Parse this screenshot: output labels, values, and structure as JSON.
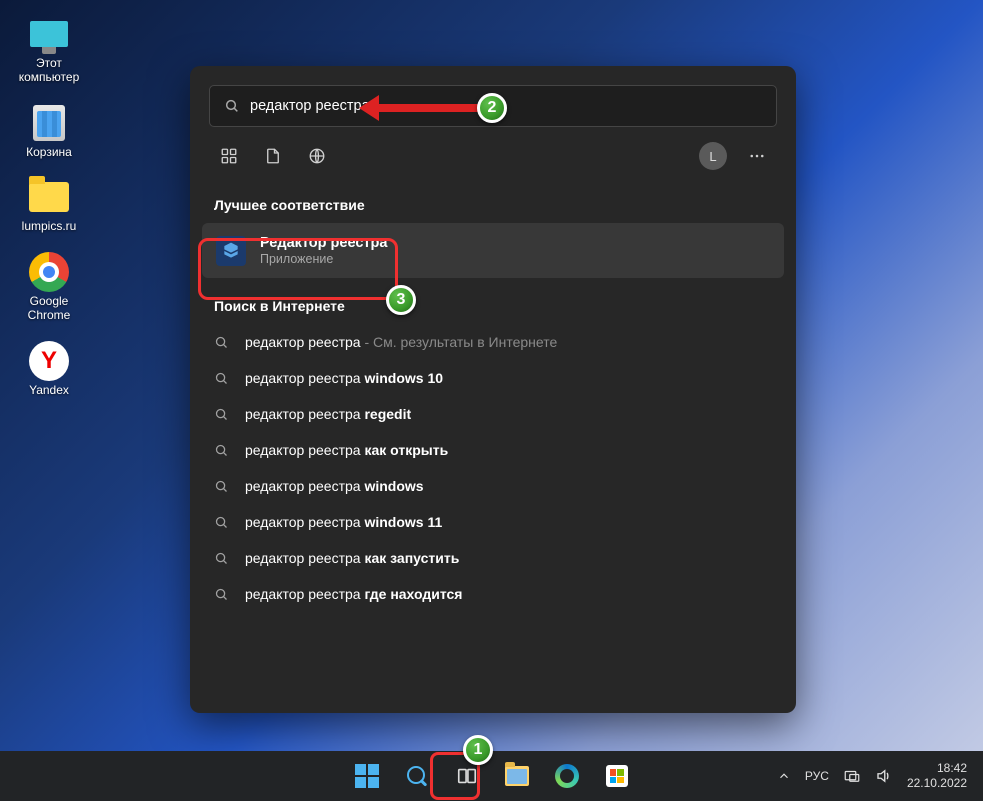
{
  "desktop": {
    "this_pc": "Этот\nкомпьютер",
    "recycle_bin": "Корзина",
    "folder": "lumpics.ru",
    "chrome": "Google\nChrome",
    "yandex": "Yandex"
  },
  "search": {
    "query": "редактор реестра",
    "best_match_heading": "Лучшее соответствие",
    "best_match": {
      "title": "Редактор реестра",
      "subtitle": "Приложение"
    },
    "web_heading": "Поиск в Интернете",
    "web": [
      {
        "prefix": "редактор реестра",
        "suffix": " - См. результаты в Интернете",
        "bold": ""
      },
      {
        "prefix": "редактор реестра ",
        "bold": "windows 10"
      },
      {
        "prefix": "редактор реестра ",
        "bold": "regedit"
      },
      {
        "prefix": "редактор реестра ",
        "bold": "как открыть"
      },
      {
        "prefix": "редактор реестра ",
        "bold": "windows"
      },
      {
        "prefix": "редактор реестра ",
        "bold": "windows 11"
      },
      {
        "prefix": "редактор реестра ",
        "bold": "как запустить"
      },
      {
        "prefix": "редактор реестра ",
        "bold": "где находится"
      }
    ],
    "avatar_letter": "L"
  },
  "taskbar": {
    "lang": "РУС",
    "time": "18:42",
    "date": "22.10.2022"
  },
  "badges": {
    "b1": "1",
    "b2": "2",
    "b3": "3"
  }
}
